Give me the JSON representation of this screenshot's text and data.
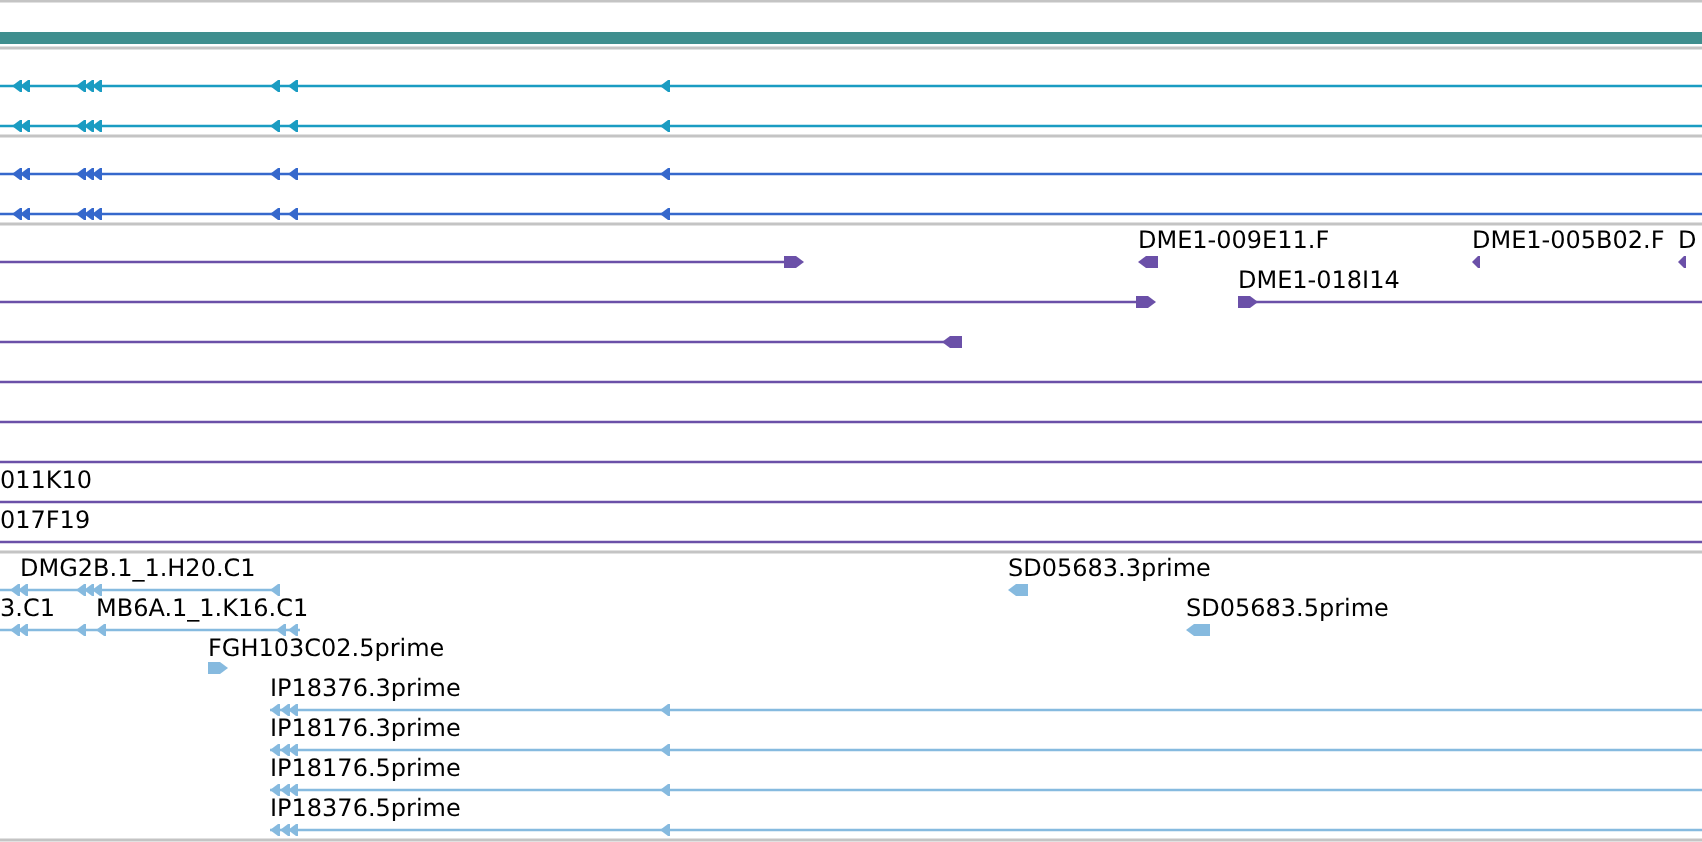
{
  "tracks": [
    {
      "color": "#1a9cc2"
    },
    {
      "color": "#3568cc"
    },
    {
      "color": "#6b50a8",
      "features": [
        {
          "label": "DME1-009E11.F"
        },
        {
          "label": "DME1-005B02.F"
        },
        {
          "label": "D"
        },
        {
          "label": "DME1-018I14"
        },
        {
          "label": "011K10"
        },
        {
          "label": "017F19"
        }
      ]
    },
    {
      "color": "#86badf",
      "features": [
        {
          "label": "DMG2B.1_1.H20.C1"
        },
        {
          "label": "3.C1"
        },
        {
          "label": "MB6A.1_1.K16.C1"
        },
        {
          "label": "FGH103C02.5prime"
        },
        {
          "label": "SD05683.3prime"
        },
        {
          "label": "SD05683.5prime"
        },
        {
          "label": "IP18376.3prime"
        },
        {
          "label": "IP18176.3prime"
        },
        {
          "label": "IP18176.5prime"
        },
        {
          "label": "IP18376.5prime"
        }
      ]
    }
  ]
}
